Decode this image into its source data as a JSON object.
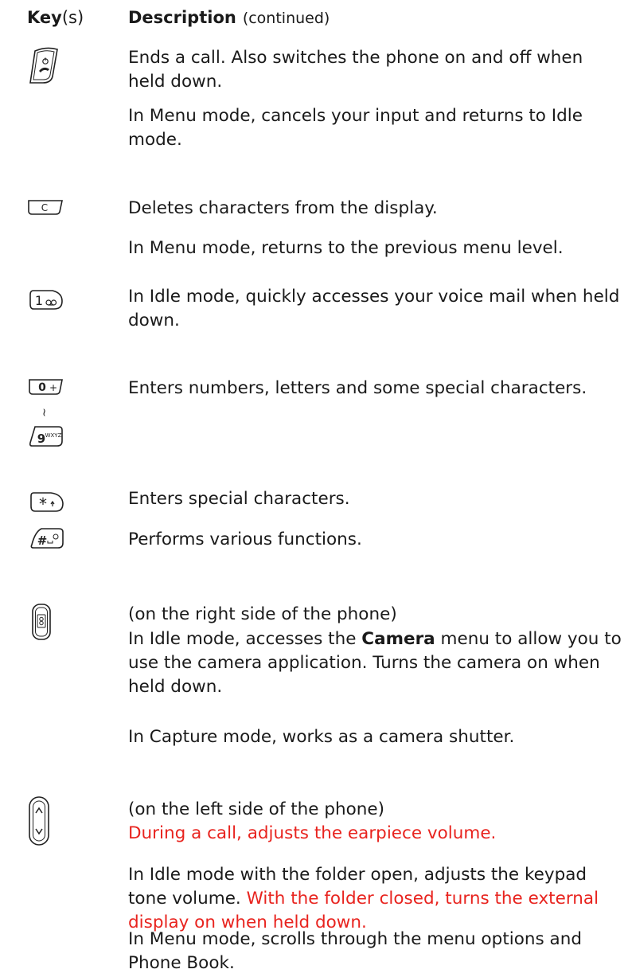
{
  "header": {
    "key_bold": "Key",
    "key_suffix": "(s)",
    "description": "Description",
    "continued": "(continued)"
  },
  "rows": [
    {
      "icon": "end-call-key-icon",
      "paragraphs": [
        "Ends a call. Also switches the phone on and off when held down.",
        "In Menu mode, cancels your input and returns to Idle mode."
      ]
    },
    {
      "icon": "clear-c-key-icon",
      "key_label": "C",
      "paragraphs": [
        "Deletes characters from the display.",
        "In Menu mode, returns to the previous menu level."
      ]
    },
    {
      "icon": "one-voicemail-key-icon",
      "key_label": "1",
      "paragraphs": [
        "In Idle mode, quickly accesses your voice mail when held down."
      ]
    },
    {
      "icon": "number-keys-icon",
      "key_labels": [
        "0",
        "+",
        "~",
        "9",
        "WXYZ"
      ],
      "paragraphs": [
        "Enters numbers, letters and some special characters."
      ]
    },
    {
      "icon": "star-hash-keys-icon",
      "key_labels": [
        "*",
        "#"
      ],
      "paragraphs": [
        "Enters special characters.",
        "Performs various functions."
      ]
    },
    {
      "icon": "camera-side-key-icon",
      "paragraphs": [
        "(on the right side of the phone)",
        "In Idle mode, accesses the ",
        "Camera",
        " menu to allow you to use the camera application. Turns the camera on when held down.",
        "In Capture mode, works as a camera shutter."
      ]
    },
    {
      "icon": "volume-side-key-icon",
      "paragraphs": [
        "(on the left side of the phone)",
        "During a call, adjusts the earpiece volume.",
        "In Idle mode with the folder open, adjusts the keypad tone volume. ",
        "With the folder closed, turns the external display on when held down.",
        "In Menu mode, scrolls through the menu options and Phone Book."
      ]
    }
  ],
  "colors": {
    "text": "#1a1a1a",
    "highlight": "#e8231e"
  }
}
